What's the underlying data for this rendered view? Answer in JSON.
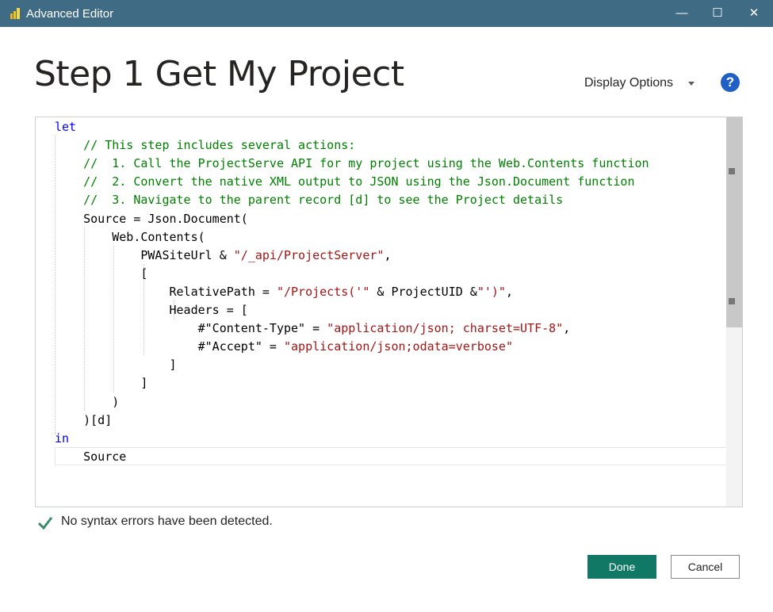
{
  "window": {
    "title": "Advanced Editor",
    "app_icon": "power-bi-icon",
    "controls": {
      "minimize": "—",
      "maximize": "☐",
      "close": "✕"
    }
  },
  "query_name": "Step 1 Get My Project",
  "toolbar": {
    "display_options_label": "Display Options",
    "help_symbol": "?"
  },
  "editor": {
    "lines": [
      [
        {
          "t": "let",
          "c": "kw"
        }
      ],
      [
        {
          "t": "    "
        },
        {
          "t": "// This step includes several actions:",
          "c": "cm"
        }
      ],
      [
        {
          "t": "    "
        },
        {
          "t": "//  1. Call the ProjectServe API for my project using the Web.Contents function",
          "c": "cm"
        }
      ],
      [
        {
          "t": "    "
        },
        {
          "t": "//  2. Convert the native XML output to JSON using the Json.Document function",
          "c": "cm"
        }
      ],
      [
        {
          "t": "    "
        },
        {
          "t": "//  3. Navigate to the parent record [d] to see the Project details",
          "c": "cm"
        }
      ],
      [
        {
          "t": "    Source = Json.Document("
        }
      ],
      [
        {
          "t": "        Web.Contents("
        }
      ],
      [
        {
          "t": "            PWASiteUrl & "
        },
        {
          "t": "\"/_api/ProjectServer\"",
          "c": "str"
        },
        {
          "t": ","
        }
      ],
      [
        {
          "t": "            ["
        }
      ],
      [
        {
          "t": "                RelativePath = "
        },
        {
          "t": "\"/Projects('\"",
          "c": "str"
        },
        {
          "t": " & ProjectUID &"
        },
        {
          "t": "\"')\"",
          "c": "str"
        },
        {
          "t": ","
        }
      ],
      [
        {
          "t": "                Headers = ["
        }
      ],
      [
        {
          "t": "                    #\"Content-Type\" = "
        },
        {
          "t": "\"application/json; charset=UTF-8\"",
          "c": "str"
        },
        {
          "t": ","
        }
      ],
      [
        {
          "t": "                    #\"Accept\" = "
        },
        {
          "t": "\"application/json;odata=verbose\"",
          "c": "str"
        }
      ],
      [
        {
          "t": "                ]"
        }
      ],
      [
        {
          "t": "            ]"
        }
      ],
      [
        {
          "t": "        )"
        }
      ],
      [
        {
          "t": "    )[d]"
        }
      ],
      [
        {
          "t": "in",
          "c": "kw"
        }
      ],
      [
        {
          "t": "    Source"
        }
      ]
    ]
  },
  "status": {
    "icon": "checkmark-icon",
    "text": "No syntax errors have been detected."
  },
  "buttons": {
    "done": "Done",
    "cancel": "Cancel"
  },
  "colors": {
    "titlebar": "#3f6c84",
    "keyword": "#0000ff",
    "comment": "#008000",
    "string": "#a31515",
    "done_button": "#117865",
    "help_icon": "#1f5fc6",
    "check": "#3c8c6e"
  }
}
